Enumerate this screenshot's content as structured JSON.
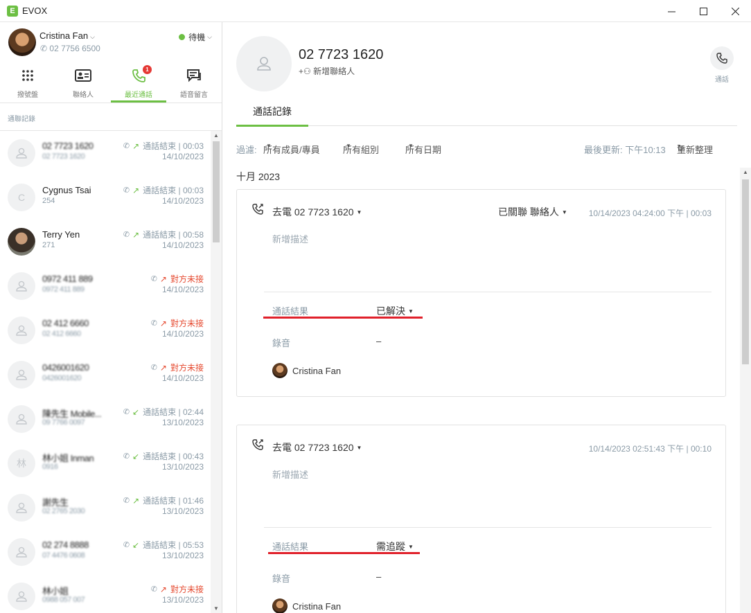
{
  "window": {
    "title": "EVOX",
    "logo": "E"
  },
  "me": {
    "name": "Cristina Fan",
    "phone": "02 7756 6500",
    "status": "待機"
  },
  "tabs": [
    {
      "label": "撥號盤",
      "icon": "dialpad-icon"
    },
    {
      "label": "聯絡人",
      "icon": "contacts-card-icon"
    },
    {
      "label": "最近通話",
      "icon": "recent-calls-icon",
      "badge": "1"
    },
    {
      "label": "語音留言",
      "icon": "voicemail-chat-icon"
    }
  ],
  "list_section_label": "通聯記錄",
  "calls": [
    {
      "name": "02 7723 1620",
      "sub": "02 7723 1620",
      "status": "通話結束 | 00:03",
      "date": "14/10/2023",
      "kind": "ok",
      "dir": "out",
      "avatar": "person",
      "blurred": true
    },
    {
      "name": "Cygnus Tsai",
      "sub": "254",
      "status": "通話結束 | 00:03",
      "date": "14/10/2023",
      "kind": "ok",
      "dir": "out",
      "avatar": "C",
      "blurred": false
    },
    {
      "name": "Terry Yen",
      "sub": "271",
      "status": "通話結束 | 00:58",
      "date": "14/10/2023",
      "kind": "ok",
      "dir": "out",
      "avatar": "photo",
      "blurred": false
    },
    {
      "name": "0972 411 889",
      "sub": "0972 411 889",
      "status": "對方未接",
      "date": "14/10/2023",
      "kind": "miss",
      "dir": "out",
      "avatar": "person",
      "blurred": true
    },
    {
      "name": "02 412 6660",
      "sub": "02 412 6660",
      "status": "對方未接",
      "date": "14/10/2023",
      "kind": "miss",
      "dir": "out",
      "avatar": "person",
      "blurred": true
    },
    {
      "name": "0426001620",
      "sub": "0426001620",
      "status": "對方未接",
      "date": "14/10/2023",
      "kind": "miss",
      "dir": "out",
      "avatar": "person",
      "blurred": true
    },
    {
      "name": "陳先生 Mobile...",
      "sub": "09 7766 0097",
      "status": "通話結束 | 02:44",
      "date": "13/10/2023",
      "kind": "ok",
      "dir": "in",
      "avatar": "person",
      "blurred": true
    },
    {
      "name": "林小姐 Inman",
      "sub": "0916",
      "status": "通話結束 | 00:43",
      "date": "13/10/2023",
      "kind": "ok",
      "dir": "in",
      "avatar": "林",
      "blurred": true
    },
    {
      "name": "謝先生",
      "sub": "02 2765 2030",
      "status": "通話結束 | 01:46",
      "date": "13/10/2023",
      "kind": "ok",
      "dir": "out",
      "avatar": "person",
      "blurred": true
    },
    {
      "name": "02 274 8888",
      "sub": "07 4476 0608",
      "status": "通話結束 | 05:53",
      "date": "13/10/2023",
      "kind": "ok",
      "dir": "in",
      "avatar": "person",
      "blurred": true
    },
    {
      "name": "林小姐",
      "sub": "0988 057 007",
      "status": "對方未接",
      "date": "13/10/2023",
      "kind": "miss",
      "dir": "out",
      "avatar": "person",
      "blurred": true
    }
  ],
  "contact": {
    "number": "02 7723 1620",
    "add_contact": "新增聯絡人",
    "call_label": "通話"
  },
  "detail_tab": "通話記錄",
  "filters": {
    "label": "過濾:",
    "members": "所有成員/專員",
    "groups": "所有組別",
    "dates": "所有日期",
    "updated": "最後更新: 下午10:13",
    "refresh": "重新整理"
  },
  "month": "十月 2023",
  "records": [
    {
      "title": "去電 02 7723 1620",
      "link": "已關聯 聯絡人",
      "time": "10/14/2023 04:24:00 下午 | 00:03",
      "desc_placeholder": "新增描述",
      "result_label": "通話結果",
      "result": "已解決",
      "rec_label": "錄音",
      "rec_value": "–",
      "user": "Cristina Fan"
    },
    {
      "title": "去電 02 7723 1620",
      "link": "",
      "time": "10/14/2023 02:51:43 下午 | 00:10",
      "desc_placeholder": "新增描述",
      "result_label": "通話結果",
      "result": "需追蹤",
      "rec_label": "錄音",
      "rec_value": "–",
      "user": "Cristina Fan"
    }
  ],
  "colors": {
    "accent": "#6cbf43",
    "missed": "#e5482e",
    "badge": "#e53935",
    "muted": "#8a9aa6",
    "highlight": "#e0202a"
  }
}
